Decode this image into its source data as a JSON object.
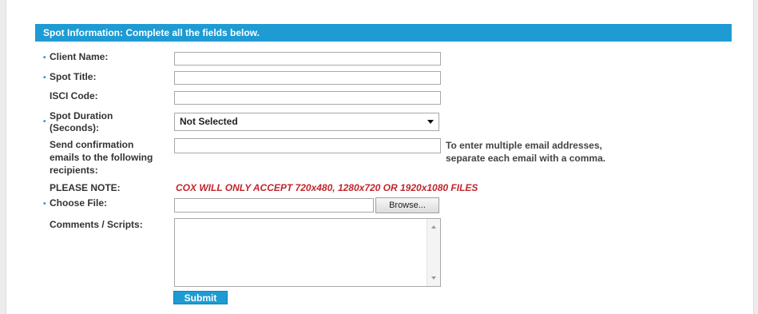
{
  "form": {
    "header": "Spot Information: Complete all the fields below.",
    "required_marker": "•",
    "fields": {
      "client_name": {
        "label": "Client Name:",
        "value": ""
      },
      "spot_title": {
        "label": "Spot Title:",
        "value": ""
      },
      "isci_code": {
        "label": "ISCI Code:",
        "value": ""
      },
      "spot_duration": {
        "label_line1": "Spot Duration",
        "label_line2": "(Seconds):",
        "selected": "Not Selected"
      },
      "confirmation_emails": {
        "label_line1": "Send confirmation",
        "label_line2": "emails to the following",
        "label_line3": "recipients:",
        "value": "",
        "hint_line1": "To enter multiple email addresses,",
        "hint_line2": "separate each email with a comma."
      },
      "please_note": {
        "label": "PLEASE NOTE:",
        "text": "COX WILL ONLY ACCEPT 720x480, 1280x720 OR 1920x1080 FILES"
      },
      "choose_file": {
        "label": "Choose File:",
        "value": "",
        "browse_label": "Browse..."
      },
      "comments": {
        "label": "Comments / Scripts:",
        "value": ""
      }
    },
    "submit_label": "Submit"
  },
  "colors": {
    "accent": "#1e9bd3",
    "note_red": "#c0262d"
  }
}
